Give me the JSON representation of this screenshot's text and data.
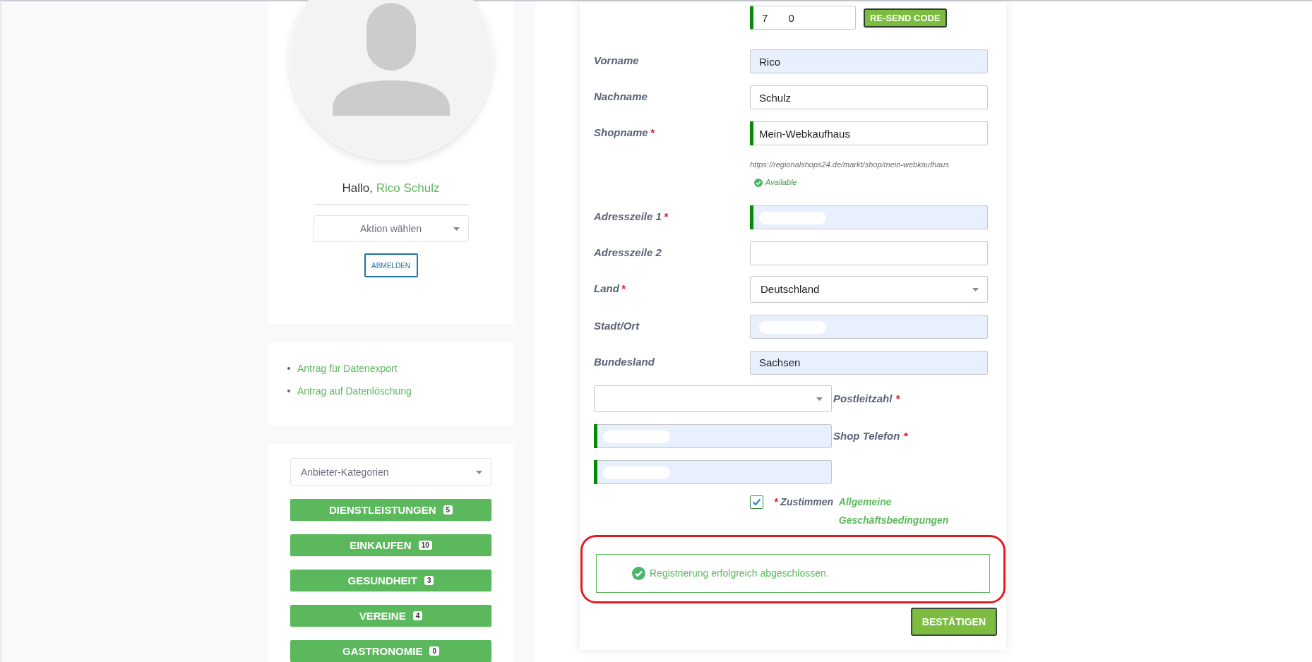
{
  "profile": {
    "greeting": "Hallo,",
    "name": "Rico Schulz",
    "action_select": "Aktion wählen",
    "logout": "ABMELDEN"
  },
  "privacy_links": [
    "Antrag für Datenexport",
    "Antrag auf Datenlöschung"
  ],
  "categories": {
    "select": "Anbieter-Kategorien",
    "items": [
      {
        "label": "DIENSTLEISTUNGEN",
        "count": "5"
      },
      {
        "label": "EINKAUFEN",
        "count": "10"
      },
      {
        "label": "GESUNDHEIT",
        "count": "3"
      },
      {
        "label": "VEREINE",
        "count": "4"
      },
      {
        "label": "GASTRONOMIE",
        "count": "0"
      }
    ]
  },
  "form": {
    "rows": [
      {
        "kind": "code",
        "value": "7       0",
        "valid": true,
        "button": "RE-SEND CODE"
      },
      {
        "kind": "input",
        "label": "Vorname",
        "value": "Rico",
        "autofilled": true
      },
      {
        "kind": "input",
        "label": "Nachname",
        "value": "Schulz"
      },
      {
        "kind": "input",
        "label": "Shopname",
        "mark": "*",
        "value": "Mein-Webkaufhaus",
        "valid": true
      },
      {
        "kind": "hint",
        "url": "https://regionalshops24.de/markt/shop/mein-webkaufhaus",
        "status": "Available"
      },
      {
        "kind": "input",
        "label": "Adresszeile 1",
        "mark": "*",
        "autofilled": true,
        "valid": true,
        "redacted": true
      },
      {
        "kind": "input",
        "label": "Adresszeile 2"
      },
      {
        "kind": "select",
        "label": "Land",
        "mark": "*",
        "value": "Deutschland"
      },
      {
        "kind": "input",
        "label": "Stadt/Ort",
        "autofilled": true,
        "redacted": true
      },
      {
        "kind": "input",
        "label": "Bundesland",
        "value": "Sachsen",
        "autofilled": true
      },
      {
        "kind": "select-left",
        "label": "Postleitzahl",
        "mark": "*"
      },
      {
        "kind": "input-left",
        "label": "Shop Telefon",
        "mark": "*",
        "autofilled": true,
        "valid": true,
        "redacted": true
      },
      {
        "kind": "input-left",
        "autofilled": true,
        "valid": true,
        "redacted": true
      }
    ],
    "agree": {
      "checked": true,
      "mark": "*",
      "text": "Zustimmen",
      "link": "Allgemeine Geschäftsbedingungen"
    },
    "alert": {
      "text": "Registrierung erfolgreich abgeschlossen.",
      "highlighted": true
    },
    "submit": "BESTÄTIGEN"
  }
}
